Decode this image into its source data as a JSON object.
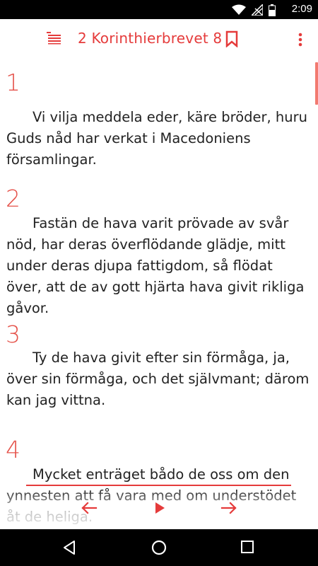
{
  "status_bar": {
    "time": "2:09"
  },
  "app_bar": {
    "title": "2 Korinthierbrevet 8"
  },
  "colors": {
    "accent": "#e53b3b",
    "verse_number": "#e5524a",
    "text": "#222222"
  },
  "verses": [
    {
      "number": "1",
      "text": "Vi vilja meddela eder, käre bröder, huru Guds nåd har verkat i Macedoniens församlingar."
    },
    {
      "number": "2",
      "text": "Fastän de hava varit prövade av svår nöd, har deras överflödande glädje, mitt under deras djupa fattigdom, så flödat över, att de av gott hjärta hava givit rikliga gåvor."
    },
    {
      "number": "3",
      "text": "Ty de hava givit efter sin förmåga, ja, över sin förmåga, och det självmant; därom kan jag vittna."
    },
    {
      "number": "4",
      "text": "Mycket enträget bådo de oss om den ynnesten att få vara med om understödet åt de heliga."
    }
  ],
  "icons": {
    "table_of_contents": "toc-list-icon",
    "bookmark": "bookmark-icon",
    "more": "more-vert-icon",
    "previous": "arrow-left-icon",
    "play": "play-icon",
    "next": "arrow-right-icon"
  }
}
